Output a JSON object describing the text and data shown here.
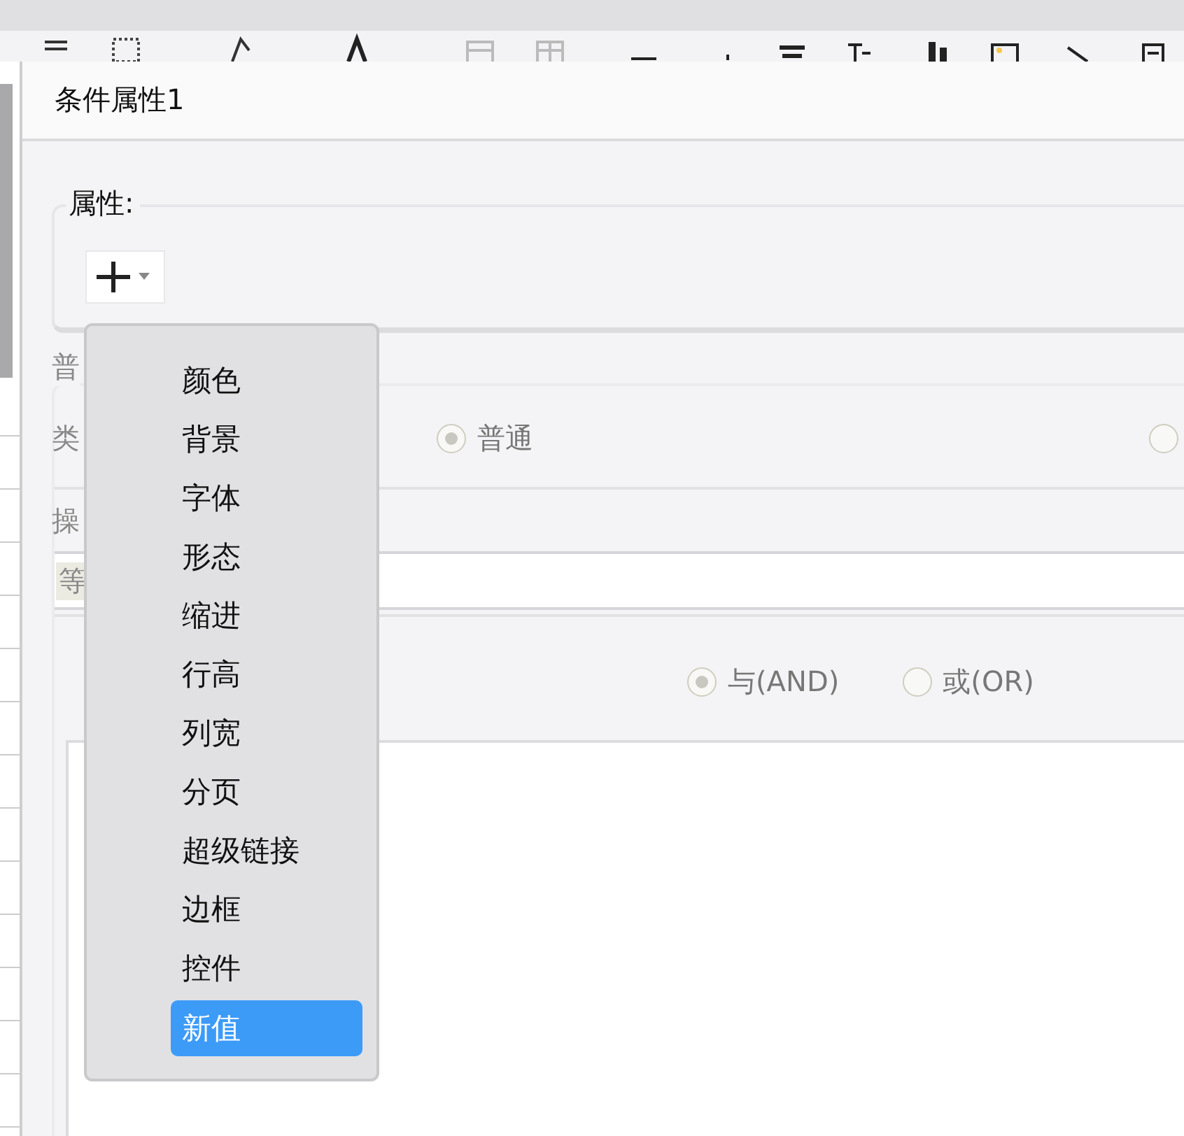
{
  "dialog": {
    "title": "条件属性1"
  },
  "attributes": {
    "label": "属性:"
  },
  "menu": {
    "items": [
      {
        "label": "颜色",
        "selected": false
      },
      {
        "label": "背景",
        "selected": false
      },
      {
        "label": "字体",
        "selected": false
      },
      {
        "label": "形态",
        "selected": false
      },
      {
        "label": "缩进",
        "selected": false
      },
      {
        "label": "行高",
        "selected": false
      },
      {
        "label": "列宽",
        "selected": false
      },
      {
        "label": "分页",
        "selected": false
      },
      {
        "label": "超级链接",
        "selected": false
      },
      {
        "label": "边框",
        "selected": false
      },
      {
        "label": "控件",
        "selected": false
      },
      {
        "label": "新值",
        "selected": true
      }
    ]
  },
  "condition": {
    "label": "普",
    "type_label": "类",
    "type_options": [
      {
        "label": "普通",
        "selected": true
      },
      {
        "selected": false
      }
    ],
    "operation_label": "操",
    "value_tag": "等",
    "logic_options": [
      {
        "label": "与(AND)",
        "selected": true
      },
      {
        "label": "或(OR)",
        "selected": false
      }
    ]
  }
}
